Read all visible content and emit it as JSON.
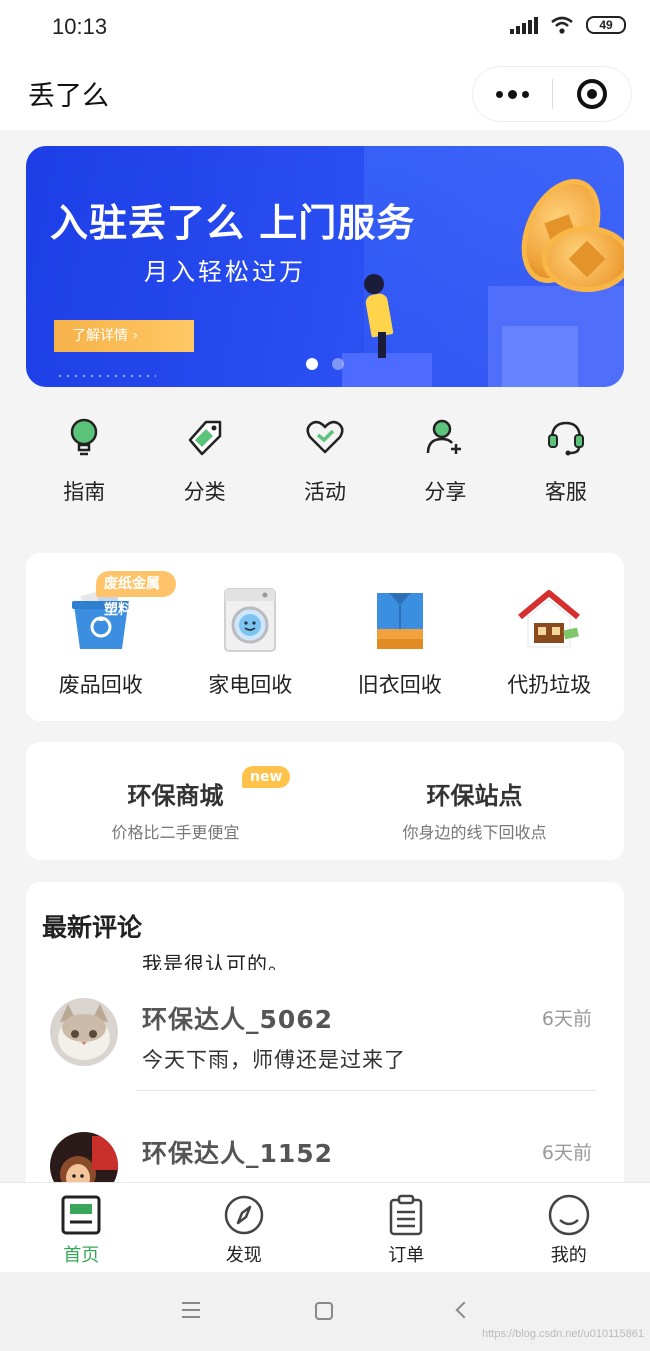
{
  "status_bar": {
    "time": "10:13",
    "battery": "49"
  },
  "nav": {
    "title": "丢了么"
  },
  "banner": {
    "title": "入驻丢了么 上门服务",
    "subtitle": "月入轻松过万",
    "button_label": "了解详情 ›"
  },
  "quick_menu": [
    {
      "label": "指南",
      "icon": "lightbulb-icon"
    },
    {
      "label": "分类",
      "icon": "tag-icon"
    },
    {
      "label": "活动",
      "icon": "heart-icon"
    },
    {
      "label": "分享",
      "icon": "add-user-icon"
    },
    {
      "label": "客服",
      "icon": "headset-icon"
    }
  ],
  "categories": [
    {
      "label": "废品回收",
      "badge": "废纸金属塑料",
      "icon": "recycle-bin-icon"
    },
    {
      "label": "家电回收",
      "icon": "washing-machine-icon"
    },
    {
      "label": "旧衣回收",
      "icon": "clothes-icon"
    },
    {
      "label": "代扔垃圾",
      "icon": "house-icon"
    }
  ],
  "store": [
    {
      "title": "环保商城",
      "subtitle": "价格比二手更便宜",
      "badge": "new"
    },
    {
      "title": "环保站点",
      "subtitle": "你身边的线下回收点"
    }
  ],
  "comments": {
    "title": "最新评论",
    "cut_text": "我是很认可的。",
    "items": [
      {
        "name": "环保达人_5062",
        "time": "6天前",
        "text": "今天下雨，师傅还是过来了"
      },
      {
        "name": "环保达人_1152",
        "time": "6天前",
        "text": ""
      }
    ]
  },
  "tabs": [
    {
      "label": "首页",
      "active": true,
      "icon": "home-icon"
    },
    {
      "label": "发现",
      "icon": "compass-icon"
    },
    {
      "label": "订单",
      "icon": "clipboard-icon"
    },
    {
      "label": "我的",
      "icon": "smile-icon"
    }
  ],
  "watermark": "https://blog.csdn.net/u010115861",
  "colors": {
    "accent": "#3aa65a",
    "banner": "#2a4ff2",
    "badge": "#ffc36a"
  }
}
